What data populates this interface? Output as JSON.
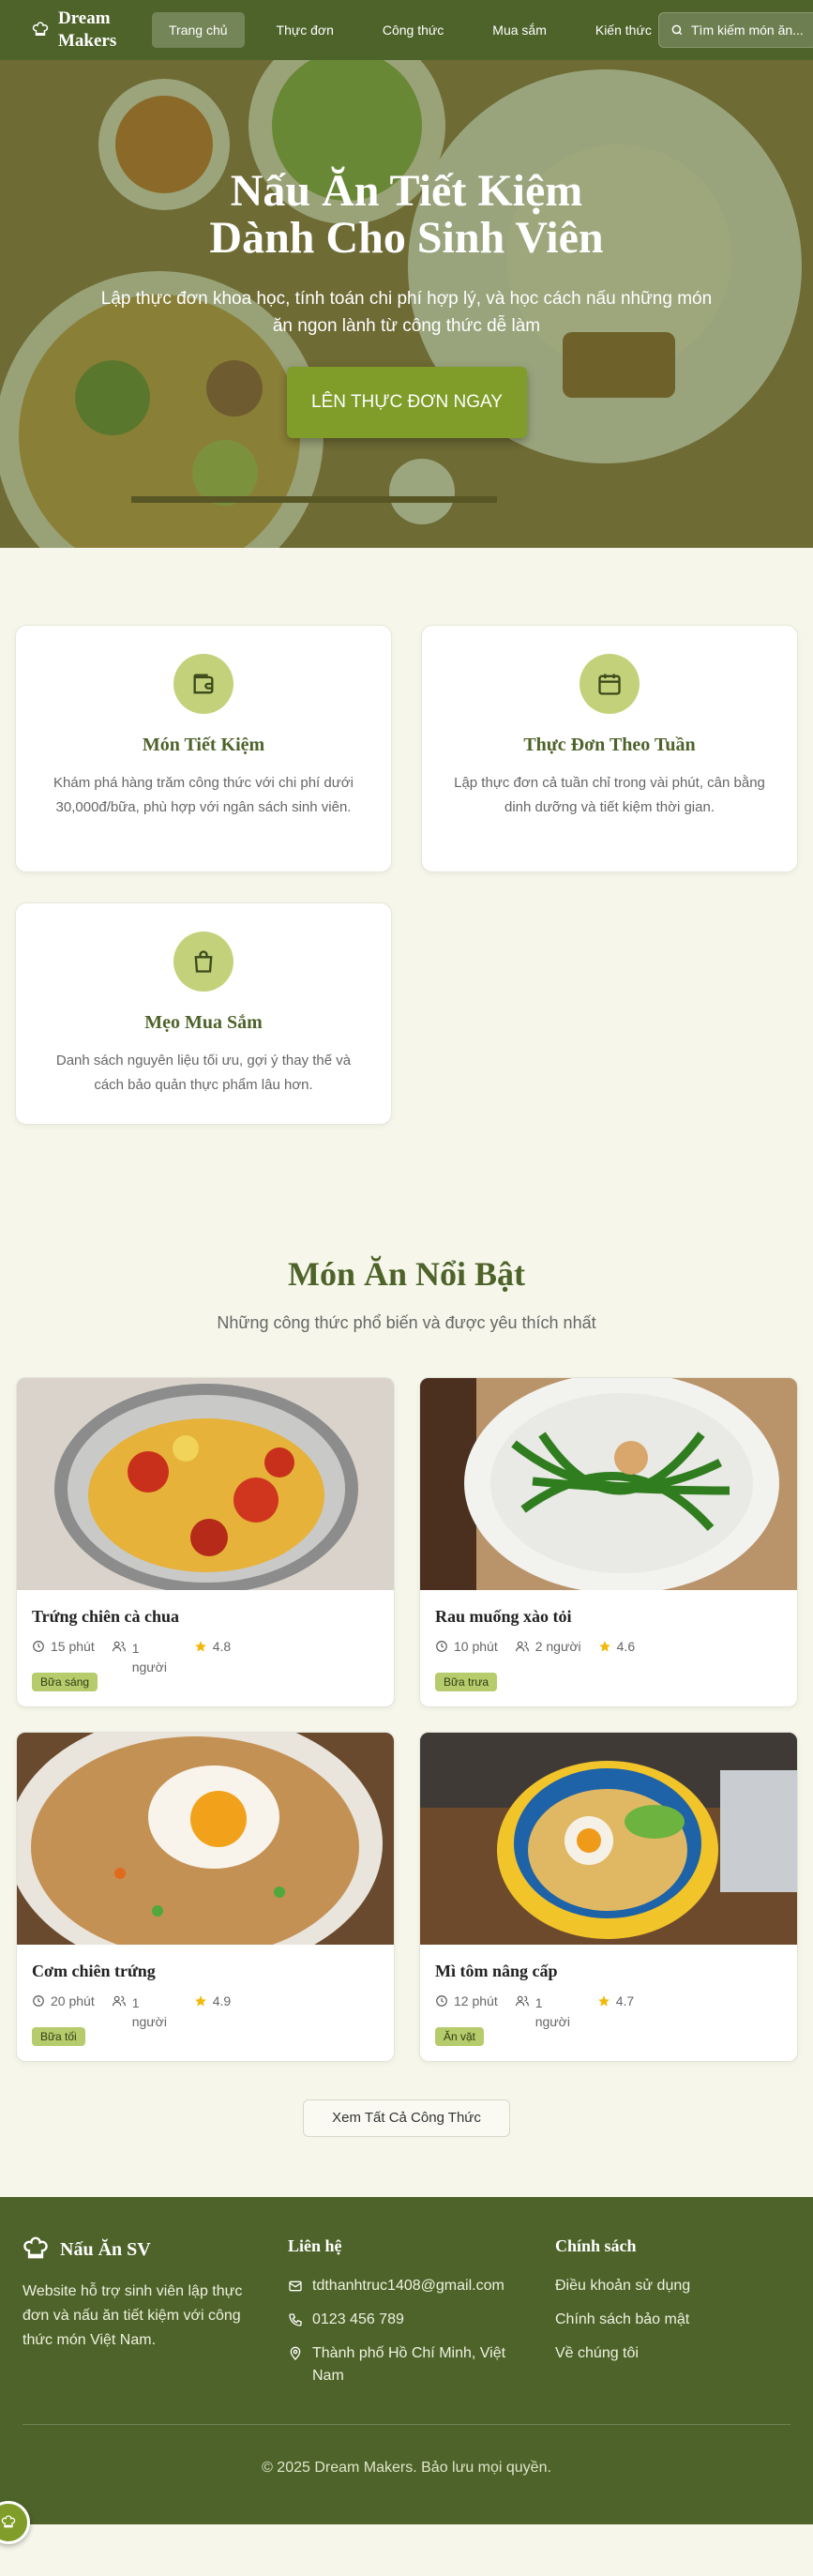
{
  "nav": {
    "brand": "Dream Makers",
    "links": [
      "Trang chủ",
      "Thực đơn",
      "Công thức",
      "Mua sắm",
      "Kiến thức"
    ],
    "active_index": 0,
    "search_placeholder": "Tìm kiếm món ăn..."
  },
  "hero": {
    "title_line1": "Nấu Ăn Tiết Kiệm",
    "title_line2": "Dành Cho Sinh Viên",
    "subtitle": "Lập thực đơn khoa học, tính toán chi phí hợp lý, và học cách nấu những món ăn ngon lành từ công thức dễ làm",
    "cta": "LÊN THỰC ĐƠN NGAY"
  },
  "features": [
    {
      "icon": "wallet-icon",
      "title": "Món Tiết Kiệm",
      "desc": "Khám phá hàng trăm công thức với chi phí dưới 30,000đ/bữa, phù hợp với ngân sách sinh viên."
    },
    {
      "icon": "calendar-icon",
      "title": "Thực Đơn Theo Tuần",
      "desc": "Lập thực đơn cả tuần chỉ trong vài phút, cân bằng dinh dưỡng và tiết kiệm thời gian."
    },
    {
      "icon": "shopping-bag-icon",
      "title": "Mẹo Mua Sắm",
      "desc": "Danh sách nguyên liệu tối ưu, gợi ý thay thế và cách bảo quản thực phẩm lâu hơn."
    }
  ],
  "featured": {
    "title": "Món Ăn Nổi Bật",
    "subtitle": "Những công thức phổ biến và được yêu thích nhất",
    "recipes": [
      {
        "name": "Trứng chiên cà chua",
        "time": "15 phút",
        "people": "1 người",
        "rating": "4.8",
        "tag": "Bữa sáng"
      },
      {
        "name": "Rau muống xào tỏi",
        "time": "10 phút",
        "people": "2 người",
        "rating": "4.6",
        "tag": "Bữa trưa"
      },
      {
        "name": "Cơm chiên trứng",
        "time": "20 phút",
        "people": "1 người",
        "rating": "4.9",
        "tag": "Bữa tối"
      },
      {
        "name": "Mì tôm nâng cấp",
        "time": "12 phút",
        "people": "1 người",
        "rating": "4.7",
        "tag": "Ăn vặt"
      }
    ],
    "view_all": "Xem Tất Cả Công Thức"
  },
  "footer": {
    "brand": "Nấu Ăn SV",
    "desc": "Website hỗ trợ sinh viên lập thực đơn và nấu ăn tiết kiệm với công thức món Việt Nam.",
    "contact_title": "Liên hệ",
    "email": "tdthanhtruc1408@gmail.com",
    "phone": "0123 456 789",
    "address": "Thành phố Hồ Chí Minh, Việt Nam",
    "policy_title": "Chính sách",
    "policies": [
      "Điều khoản sử dụng",
      "Chính sách bảo mật",
      "Về chúng tôi"
    ],
    "copyright": "© 2025 Dream Makers. Bảo lưu mọi quyền."
  },
  "colors": {
    "primary": "#4e632a",
    "accent": "#7f9d28",
    "icon_bg": "#c3d27a",
    "tag_bg": "#b6cb6c",
    "background": "#f6f7ea"
  }
}
